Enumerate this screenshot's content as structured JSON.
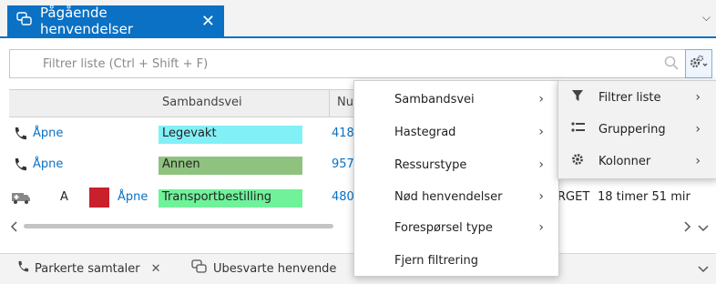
{
  "top_tab": {
    "title": "Pågående henvendelser",
    "close_glyph": "✕",
    "icon": "chat-bubbles-icon"
  },
  "top_chevron": "⌵",
  "filter": {
    "placeholder": "Filtrer liste (Ctrl + Shift + F)",
    "value": ""
  },
  "grid": {
    "headers": [
      "Sambandsvei",
      "Nu"
    ],
    "rows": [
      {
        "icon": "phone-icon",
        "action": "Åpne",
        "sambandsvei": "Legevakt",
        "sambandsvei_color": "#82f0f7",
        "nr": "418"
      },
      {
        "icon": "phone-icon",
        "action": "Åpne",
        "sambandsvei": "Annen",
        "sambandsvei_color": "#8fc27f",
        "nr": "957"
      },
      {
        "icon": "ambulance-icon",
        "letter": "A",
        "status_color": "#c8202c",
        "action": "Åpne",
        "sambandsvei": "Transportbestilling",
        "sambandsvei_color": "#6ff29a",
        "nr": "480",
        "extra": "RGET",
        "time": "18 timer 51 mir"
      }
    ]
  },
  "context_menu": {
    "items": [
      {
        "label": "Sambandsvei",
        "has_sub": true
      },
      {
        "label": "Hastegrad",
        "has_sub": true
      },
      {
        "label": "Ressurstype",
        "has_sub": true
      },
      {
        "label": "Nød henvendelser",
        "has_sub": true
      },
      {
        "label": "Forespørsel type",
        "has_sub": true
      },
      {
        "label": "Fjern filtrering",
        "has_sub": false
      }
    ]
  },
  "settings_menu": {
    "items": [
      {
        "label": "Filtrer liste",
        "icon": "funnel-icon"
      },
      {
        "label": "Gruppering",
        "icon": "list-icon"
      },
      {
        "label": "Kolonner",
        "icon": "gear-icon"
      }
    ]
  },
  "bottom_tabs": [
    {
      "label": "Parkerte samtaler",
      "icon": "phone-icon",
      "close_glyph": "✕"
    },
    {
      "label": "Ubesvarte henvende",
      "icon": "chat-bubbles-icon"
    }
  ]
}
